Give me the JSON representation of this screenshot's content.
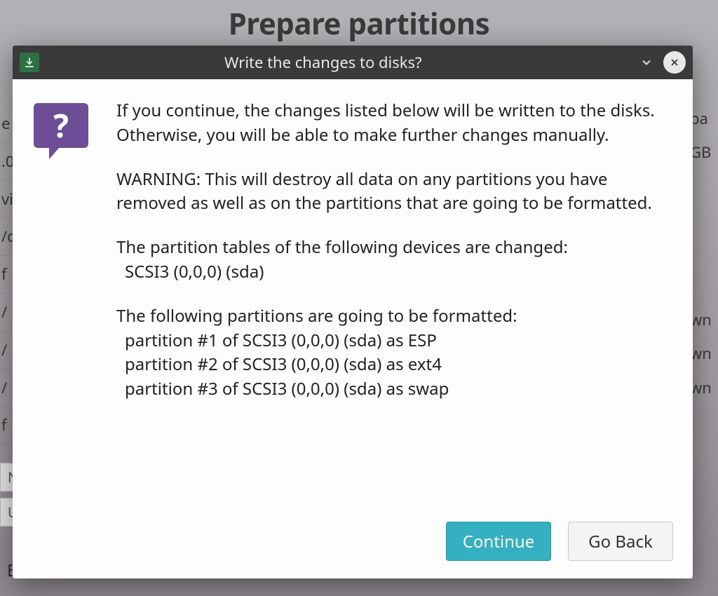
{
  "background": {
    "page_title": "Prepare partitions",
    "boot_loader_label": "Boot loader",
    "left_fragments": [
      "e",
      ".0",
      "vic",
      "/d",
      "f",
      "/",
      "/",
      "/",
      "f"
    ],
    "right_fragments": [
      "pa",
      "GB",
      "wn",
      "wn",
      "wn"
    ],
    "button_new": "New",
    "button_undo": "Und"
  },
  "dialog": {
    "title": "Write the changes to disks?",
    "intro": "If you continue, the changes listed below will be written to the disks. Otherwise, you will be able to make further changes manually.",
    "warning": "WARNING: This will destroy all data on any partitions you have removed as well as on the partitions that are going to be formatted.",
    "devices_heading": "The partition tables of the following devices are changed:",
    "devices": [
      "SCSI3 (0,0,0) (sda)"
    ],
    "partitions_heading": "The following partitions are going to be formatted:",
    "partitions": [
      "partition #1 of SCSI3 (0,0,0) (sda) as ESP",
      "partition #2 of SCSI3 (0,0,0) (sda) as ext4",
      "partition #3 of SCSI3 (0,0,0) (sda) as swap"
    ],
    "buttons": {
      "continue": "Continue",
      "go_back": "Go Back"
    }
  }
}
